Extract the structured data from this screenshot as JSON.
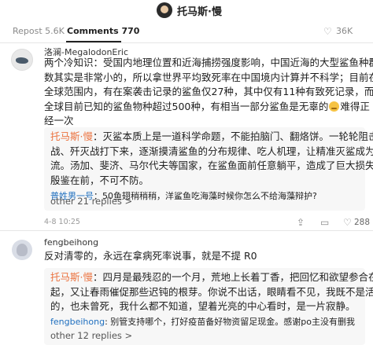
{
  "header": {
    "title": "托马斯·慢"
  },
  "tabs": {
    "repost": "Repost 5.6K",
    "comments": "Comments 770",
    "likes": "36K"
  },
  "comment1": {
    "username": "洛澜-MegalodonEric",
    "lines": [
      "两个冷知识：受国内地理位置和近海捕捞强度影响，中国近海的大型鲨鱼种群",
      "数其实是非常小的，所以拿世界平均致死率在中国境内计算并不科学；目前在",
      "全球范围内，有在案袭击记录的鲨鱼仅27种，其中仅有11种有致死记录，而",
      "全球目前已知的鲨鱼物种超过500种，有相当一部分鲨鱼是无辜的",
      "经一次"
    ],
    "line4_tail": "难得正",
    "replies": {
      "reply1_name": "托马斯·慢",
      "reply1_lines": [
        "：灭鲨本质上是一道科学命题，不能拍脑门、翻烙饼。一轮轮阻击",
        "战、歼灭战打下来，逐渐摸清鲨鱼的分布规律、吃人机理，让精准灭鲨成为主",
        "流。汤加、斐济、马尔代夫等国家，在鲨鱼面前任意躺平，造成了巨大损失，",
        "殷鉴在前，不可不防。"
      ],
      "reply2_name": "普姓男一号",
      "reply2_text": "：50鱼翅稍稍稍，洋鲨鱼吃海藻时候你怎么不给海藻辩护?",
      "more": "other 21 replies >"
    },
    "date": "4-8 10:25",
    "likes": "288"
  },
  "comment2": {
    "username": "fengbeihong",
    "text": "反对清零的，永远在拿病死率说事，就是不提 R0",
    "replies": {
      "reply1_name": "托马斯·慢",
      "reply1_lines": [
        "：四月是最残忍的一个月，荒地上长着丁香，把回忆和欲望参合在一",
        "起，又让春雨催促那些迟钝的根芽。你说不出话，眼睛看不见，我既不是活",
        "的，也未曾死，我什么都不知道，望着光亮的中心看时，是一片寂静。"
      ],
      "reply2_name": "fengbeihong",
      "reply2_text": ": 别管支持哪个，打好疫苗备好物资留足现金。感谢po主没有删我",
      "more": "other 12 replies >"
    }
  }
}
